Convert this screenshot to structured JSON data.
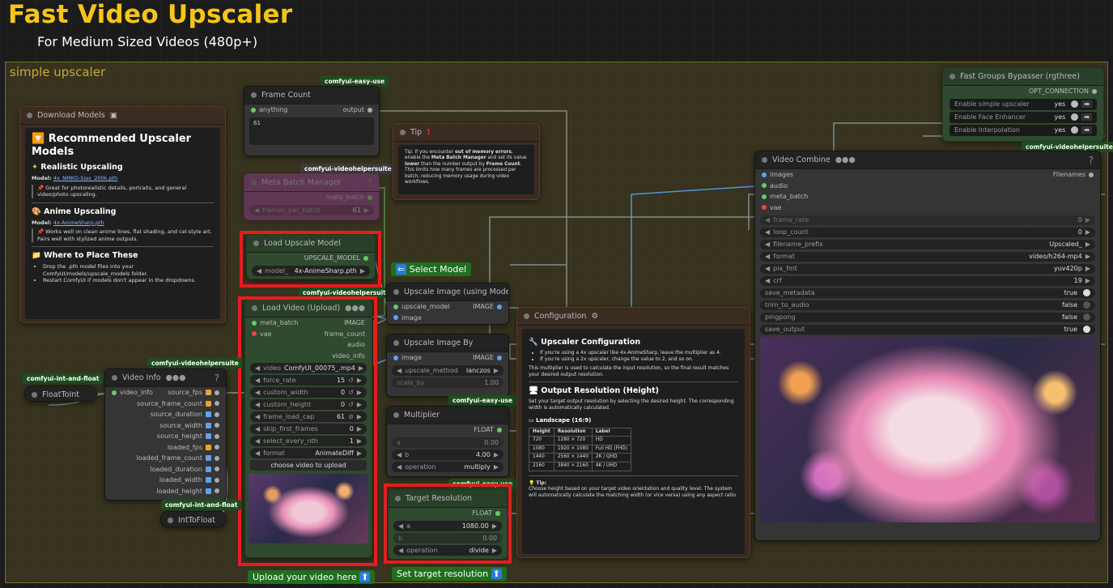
{
  "page": {
    "title": "Fast Video Upscaler",
    "subtitle": "For Medium Sized Videos (480p+)",
    "group": "simple upscaler"
  },
  "badges": {
    "easy_use_frame": "comfyui-easy-use",
    "vhs_meta": "comfyui-videohelpersuite",
    "vhs_load": "comfyui-videohelpersuite",
    "vhs_info": "comfyui-videohelpersuite",
    "intfloat_a": "comfyui-int-and-float",
    "intfloat_b": "comfyui-int-and-float",
    "easy_mult": "comfyui-easy-use",
    "easy_target": "comfyui-easy-use",
    "vhs_combine": "comfyui-videohelpersuite"
  },
  "download": {
    "title": "Download Models",
    "h1": "Recommended Upscaler Models",
    "s1": "Realistic Upscaling",
    "model1_label": "Model:",
    "model1": "4x_NMKD-Siax_200k.pth",
    "note1": "Great for photorealistic details, portraits, and general video/photo upscaling.",
    "s2": "Anime Upscaling",
    "model2_label": "Model:",
    "model2": "4x-AnimeSharp.pth",
    "note2": "Works well on clean anime lines, flat shading, and cel-style art. Pairs well with stylized anime outputs.",
    "s3": "Where to Place These",
    "b1": "Drop the .pth model files into your ComfyUI/models/upscale_models folder.",
    "b2": "Restart ComfyUI if models don't appear in the dropdowns."
  },
  "frame_count": {
    "title": "Frame Count",
    "in": "anything",
    "out": "output",
    "value": "61"
  },
  "meta_batch": {
    "title": "Meta Batch Manager",
    "out": "meta_batch",
    "w_label": "frames_per_batch",
    "w_value": "61"
  },
  "tip": {
    "title": "Tip",
    "text1": "Tip: If you encounter ",
    "b1": "out of memory errors",
    "text2": ", enable the ",
    "b2": "Meta Batch Manager",
    "text3": " and set its value ",
    "b3": "lower",
    "text4": " than the number output by ",
    "b4": "Frame Count",
    "text5": ".",
    "line2": "This limits how many frames are processed per batch, reducing memory usage during video workflows."
  },
  "load_upscale": {
    "title": "Load Upscale Model",
    "out": "UPSCALE_MODEL",
    "w_label": "model_",
    "w_value": "4x-AnimeSharp.pth"
  },
  "select_model": "Select Model",
  "upscale_image": {
    "title": "Upscale Image (using Model)",
    "in1": "upscale_model",
    "in2": "image",
    "out": "IMAGE"
  },
  "load_video": {
    "title": "Load Video (Upload)",
    "in1": "meta_batch",
    "in2": "vae",
    "outs": [
      "IMAGE",
      "frame_count",
      "audio",
      "video_info"
    ],
    "widgets": [
      {
        "l": "video",
        "v": "ComfyUI_00075_.mp4"
      },
      {
        "l": "force_rate",
        "v": "15"
      },
      {
        "l": "custom_width",
        "v": "0"
      },
      {
        "l": "custom_height",
        "v": "0"
      },
      {
        "l": "frame_load_cap",
        "v": "61"
      },
      {
        "l": "skip_first_frames",
        "v": "0"
      },
      {
        "l": "select_every_nth",
        "v": "1"
      },
      {
        "l": "format",
        "v": "AnimateDiff"
      }
    ],
    "button": "choose video to upload"
  },
  "upload_label": "Upload your video here",
  "video_info": {
    "title": "Video Info",
    "in": "video_info",
    "outs": [
      "source_fps",
      "source_frame_count",
      "source_duration",
      "source_width",
      "source_height",
      "loaded_fps",
      "loaded_frame_count",
      "loaded_duration",
      "loaded_width",
      "loaded_height"
    ]
  },
  "float_to_int": {
    "title": "FloatToInt"
  },
  "int_to_float": {
    "title": "IntToFloat"
  },
  "upscale_by": {
    "title": "Upscale Image By",
    "in": "image",
    "out": "IMAGE",
    "w1_label": "upscale_method",
    "w1_value": "lanczos",
    "w2_label": "scale_by",
    "w2_value": "1.00"
  },
  "multiplier": {
    "title": "Multiplier",
    "out": "FLOAT",
    "wa_label": "a",
    "wa_value": "0.00",
    "wb_label": "b",
    "wb_value": "4.00",
    "wop_label": "operation",
    "wop_value": "multiply"
  },
  "target": {
    "title": "Target Resolution",
    "out": "FLOAT",
    "wa_label": "a",
    "wa_value": "1080.00",
    "wb_label": "b",
    "wb_value": "0.00",
    "wop_label": "operation",
    "wop_value": "divide"
  },
  "target_label": "Set target resolution",
  "config": {
    "title": "Configuration",
    "h1": "Upscaler Configuration",
    "b1": "If you're using a 4x upscaler like 4x-AnimeSharp, leave the multiplier as 4.",
    "b2": "If you're using a 2x upscaler, change the value to 2, and so on.",
    "p1": "This multiplier is used to calculate the input resolution, so the final result matches your desired output resolution.",
    "h2": "Output Resolution (Height)",
    "p2": "Set your target output resolution by selecting the desired height. The corresponding width is automatically calculated.",
    "h3": "Landscape (16:9)",
    "table": {
      "headers": [
        "Height",
        "Resolution",
        "Label"
      ],
      "rows": [
        [
          "720",
          "1280 × 720",
          "HD"
        ],
        [
          "1080",
          "1920 × 1080",
          "Full HD (FHD)"
        ],
        [
          "1440",
          "2560 × 1440",
          "2K / QHD"
        ],
        [
          "2160",
          "3840 × 2160",
          "4K / UHD"
        ]
      ]
    },
    "tip_h": "Tip:",
    "tip": "Choose height based on your target video orientation and quality level. The system will automatically calculate the matching width (or vice versa) using any aspect ratio"
  },
  "bypasser": {
    "title": "Fast Groups Bypasser (rgthree)",
    "out": "OPT_CONNECTION",
    "rows": [
      {
        "l": "Enable simple upscaler",
        "v": "yes"
      },
      {
        "l": "Enable Face Enhancer",
        "v": "yes"
      },
      {
        "l": "Enable Interpolation",
        "v": "yes"
      }
    ]
  },
  "combine": {
    "title": "Video Combine",
    "ins": [
      "images",
      "audio",
      "meta_batch",
      "vae"
    ],
    "out": "Filenames",
    "widgets": [
      {
        "l": "frame_rate",
        "v": "0"
      },
      {
        "l": "loop_count",
        "v": "0"
      },
      {
        "l": "filename_prefix",
        "v": "Upscaled_"
      },
      {
        "l": "format",
        "v": "video/h264-mp4"
      },
      {
        "l": "pix_fmt",
        "v": "yuv420p"
      },
      {
        "l": "crf",
        "v": "19"
      }
    ],
    "toggles": [
      {
        "l": "save_metadata",
        "v": "true"
      },
      {
        "l": "trim_to_audio",
        "v": "false"
      },
      {
        "l": "pingpong",
        "v": "false"
      },
      {
        "l": "save_output",
        "v": "true"
      }
    ]
  }
}
